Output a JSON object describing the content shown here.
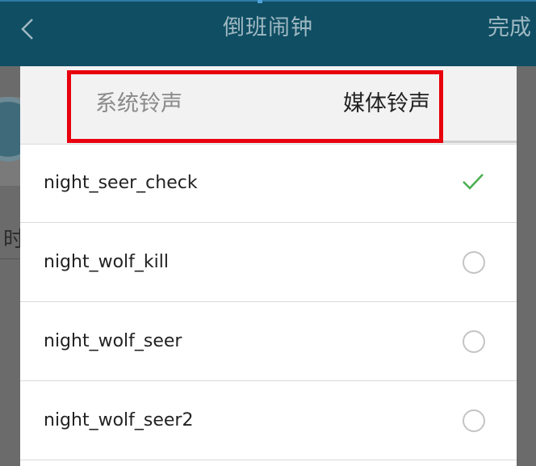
{
  "appbar": {
    "title": "倒班闹钟",
    "done_label": "完成",
    "back_icon": "chevron-left-icon"
  },
  "background": {
    "partial_char": "时"
  },
  "dialog": {
    "tabs": [
      {
        "label": "系统铃声",
        "selected": false
      },
      {
        "label": "媒体铃声",
        "selected": true
      }
    ],
    "ringtones": [
      {
        "name": "night_seer_check",
        "selected": true
      },
      {
        "name": "night_wolf_kill",
        "selected": false
      },
      {
        "name": "night_wolf_seer",
        "selected": false
      },
      {
        "name": "night_wolf_seer2",
        "selected": false
      }
    ]
  },
  "colors": {
    "appbar": "#0f4e63",
    "check": "#4caf50",
    "highlight": "#e8000d"
  }
}
